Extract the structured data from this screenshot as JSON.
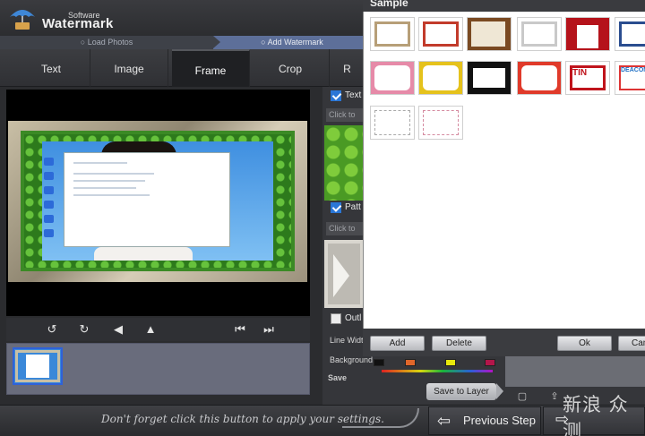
{
  "app": {
    "brand_small": "Software",
    "brand_big": "Watermark"
  },
  "steps": [
    {
      "label": "Load Photos",
      "active": false
    },
    {
      "label": "Add Watermark",
      "active": true
    }
  ],
  "tabs": [
    {
      "label": "Text",
      "active": false
    },
    {
      "label": "Image",
      "active": false
    },
    {
      "label": "Frame",
      "active": true
    },
    {
      "label": "Crop",
      "active": false
    },
    {
      "label": "R",
      "active": false
    }
  ],
  "right_panel": {
    "text_section": "Text",
    "text_hint": "Click to ac",
    "pattern_section": "Patt",
    "pattern_hint": "Click to ac",
    "outline_section": "Outl",
    "line_width_label": "Line Width",
    "background_label": "Background",
    "save_label": "Save",
    "save_to_layer": "Save to Layer"
  },
  "dialog": {
    "title": "Sample",
    "buttons": {
      "add": "Add",
      "delete": "Delete",
      "ok": "Ok",
      "cancel": "Can"
    },
    "thumbs": [
      {
        "name": "classic-frame",
        "color": "#b79f78"
      },
      {
        "name": "red-rounded-frame",
        "color": "#c23b2b"
      },
      {
        "name": "book-frame",
        "color": "#7a4a22"
      },
      {
        "name": "torn-paper-frame",
        "color": "#c9c9c9"
      },
      {
        "name": "curtain-frame",
        "color": "#b5131b"
      },
      {
        "name": "blue-frame",
        "color": "#2a4d8f"
      },
      {
        "name": "pink-heart-frame",
        "color": "#e68aa8"
      },
      {
        "name": "yellow-floral-frame",
        "color": "#e5c21c"
      },
      {
        "name": "film-frame",
        "color": "#111111"
      },
      {
        "name": "stamp-frame",
        "color": "#e03a2a"
      },
      {
        "name": "magazine-frame",
        "color": "#c0141c"
      },
      {
        "name": "cartoon-frame",
        "color": "#1e6fc4"
      },
      {
        "name": "dashed-frame-1",
        "color": "#a9a9a9"
      },
      {
        "name": "dashed-frame-2",
        "color": "#d58aa0"
      }
    ],
    "magazine_text": "TIN",
    "cartoon_text": "DEACON"
  },
  "bottom": {
    "hint": "Don't forget click this button to apply your settings.",
    "previous": "Previous Step",
    "corner_mark": "新浪 众测"
  },
  "colors": {
    "accent_blue": "#5d6f99",
    "active_tab_bg": "#1f2023"
  }
}
